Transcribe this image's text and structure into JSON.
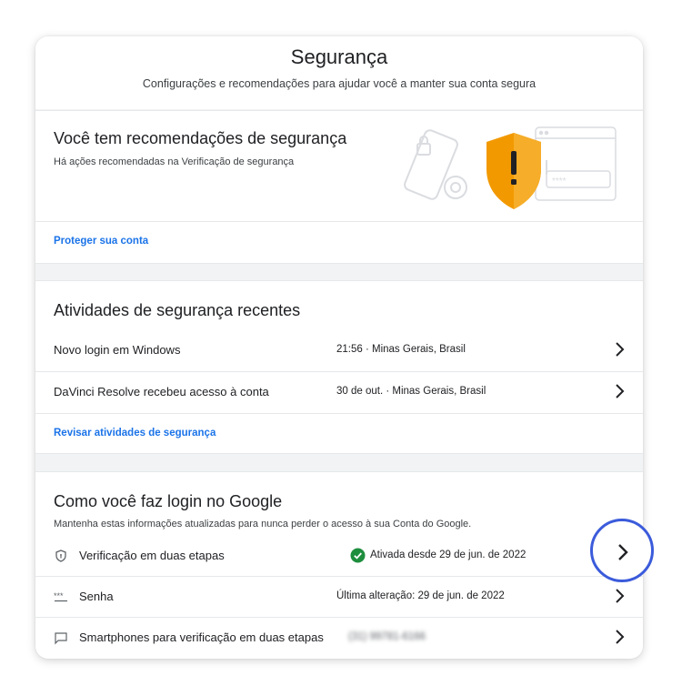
{
  "header": {
    "title": "Segurança",
    "subtitle": "Configurações e recomendações para ajudar você a manter sua conta segura"
  },
  "recommendations": {
    "title": "Você tem recomendações de segurança",
    "description": "Há ações recomendadas na Verificação de segurança",
    "illustration_icons": [
      "phone-lock-icon",
      "shield-warning-icon",
      "password-window-icon"
    ],
    "password_mask": "****",
    "link": "Proteger sua conta"
  },
  "recent_activity": {
    "title": "Atividades de segurança recentes",
    "items": [
      {
        "label": "Novo login em Windows",
        "detail": "21:56 · Minas Gerais, Brasil"
      },
      {
        "label": "DaVinci Resolve recebeu acesso à conta",
        "detail": "30 de out. · Minas Gerais, Brasil"
      }
    ],
    "link": "Revisar atividades de segurança"
  },
  "signin": {
    "title": "Como você faz login no Google",
    "description": "Mantenha estas informações atualizadas para nunca perder o acesso à sua Conta do Google.",
    "items": [
      {
        "icon": "shield-icon",
        "label": "Verificação em duas etapas",
        "status_icon": "check-circle-icon",
        "detail": "Ativada desde 29 de jun. de 2022"
      },
      {
        "icon": "password-dots-icon",
        "label": "Senha",
        "detail": "Última alteração: 29 de jun. de 2022"
      },
      {
        "icon": "message-icon",
        "label": "Smartphones para verificação em duas etapas",
        "detail": "(31) 99781-6166"
      }
    ]
  },
  "colors": {
    "link": "#1a73e8",
    "success": "#1e8e3e",
    "warning": "#f29900",
    "highlight": "#3b5bdb"
  }
}
